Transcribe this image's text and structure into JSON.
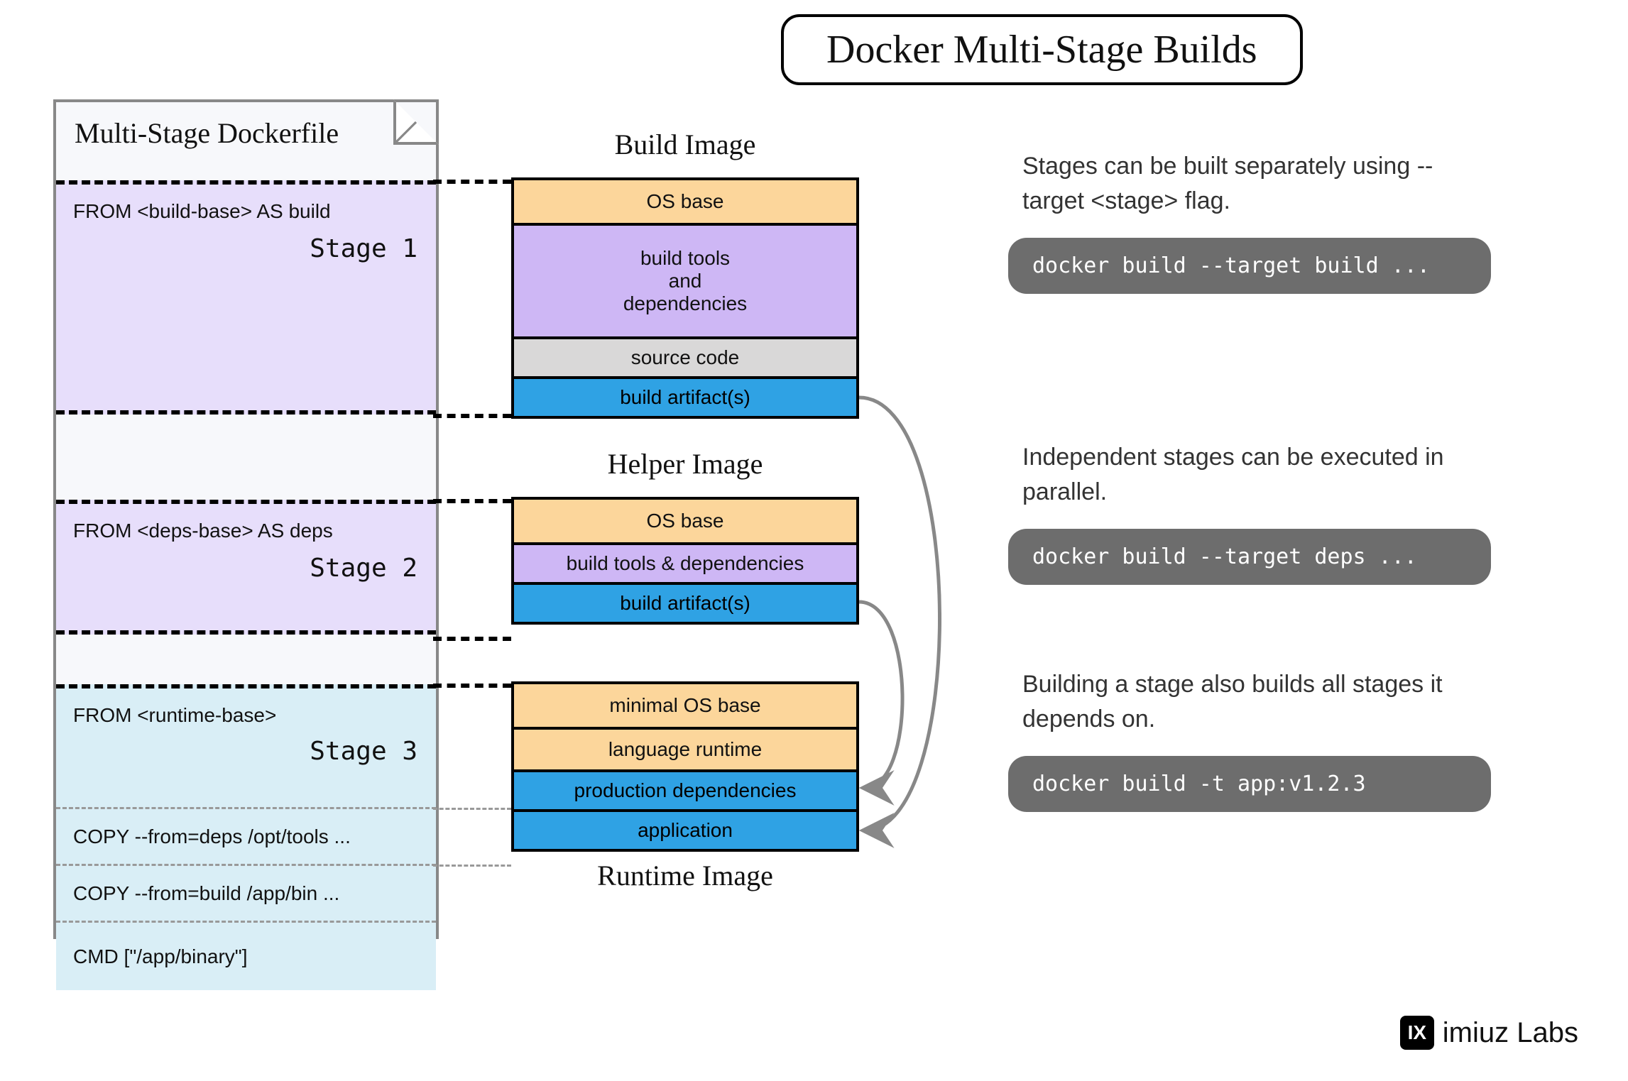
{
  "title": "Docker Multi-Stage Builds",
  "dockerfile": {
    "heading": "Multi-Stage Dockerfile",
    "stages": [
      {
        "from": "FROM <build-base> AS build",
        "label": "Stage 1"
      },
      {
        "from": "FROM <deps-base> AS deps",
        "label": "Stage 2"
      },
      {
        "from": "FROM <runtime-base>",
        "label": "Stage 3"
      }
    ],
    "commands": [
      "COPY  --from=deps /opt/tools ...",
      "COPY  --from=build /app/bin ...",
      "CMD [\"/app/binary\"]"
    ]
  },
  "images": {
    "build": {
      "title": "Build Image",
      "layers": [
        "OS base",
        "build tools\nand\ndependencies",
        "source code",
        "build artifact(s)"
      ]
    },
    "helper": {
      "title": "Helper Image",
      "layers": [
        "OS base",
        "build tools & dependencies",
        "build artifact(s)"
      ]
    },
    "runtime": {
      "title": "Runtime Image",
      "layers": [
        "minimal OS base",
        "language runtime",
        "production dependencies",
        "application"
      ]
    }
  },
  "notes": [
    {
      "text": "Stages can be built separately using --target <stage> flag.",
      "code": "docker build --target build ..."
    },
    {
      "text": "Independent stages can be executed in parallel.",
      "code": "docker build --target deps ..."
    },
    {
      "text": "Building a stage also builds all stages it depends on.",
      "code": "docker build -t app:v1.2.3"
    }
  ],
  "brand": {
    "logo": "IX",
    "name": "imiuz Labs"
  }
}
